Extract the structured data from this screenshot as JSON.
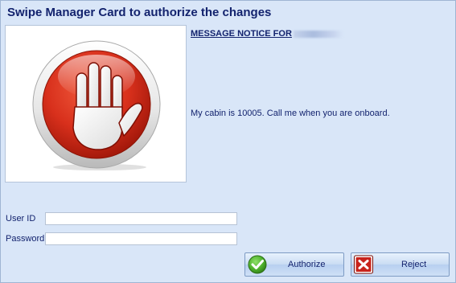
{
  "dialog": {
    "title": "Swipe Manager Card to authorize the changes"
  },
  "notice": {
    "heading": "MESSAGE NOTICE FOR",
    "message": "My cabin is 10005. Call me when you are onboard."
  },
  "form": {
    "user_id_label": "User ID",
    "user_id_value": "",
    "password_label": "Password",
    "password_value": ""
  },
  "buttons": {
    "authorize_label": "Authorize",
    "reject_label": "Reject"
  },
  "icons": {
    "stop": "stop-hand-icon",
    "authorize": "checkmark-icon",
    "reject": "x-icon"
  },
  "colors": {
    "dialog_background": "#d9e6f8",
    "text": "#13236e",
    "stop_red": "#d8301c",
    "authorize_green": "#4eb22c",
    "reject_red": "#c8231b"
  }
}
